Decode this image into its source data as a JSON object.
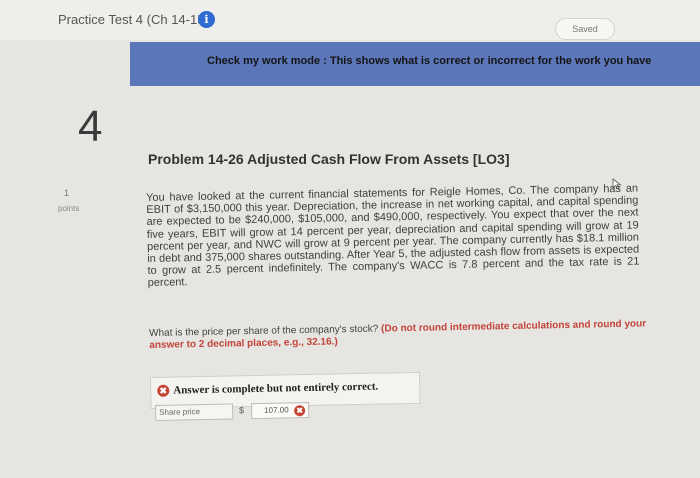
{
  "header": {
    "test_title": "Practice Test 4 (Ch 14-15)",
    "info_glyph": "i",
    "saved_label": "Saved"
  },
  "mode_banner": {
    "text": "Check my work mode : This shows what is correct or incorrect for the work you have"
  },
  "question": {
    "number": "4",
    "points_value": "1",
    "points_label": "points",
    "title": "Problem 14-26 Adjusted Cash Flow From Assets [LO3]",
    "body": "You have looked at the current financial statements for Reigle Homes, Co. The company has an EBIT of $3,150,000 this year. Depreciation, the increase in net working capital, and capital spending are expected to be $240,000, $105,000, and $490,000, respectively. You expect that over the next five years, EBIT will grow at 14 percent per year, depreciation and capital spending will grow at 19 percent per year, and NWC will grow at 9 percent per year. The company currently has $18.1 million in debt and 375,000 shares outstanding. After Year 5, the adjusted cash flow from assets is expected to grow at 2.5 percent indefinitely. The company's WACC is 7.8 percent and the tax rate is 21 percent.",
    "prompt": "What is the price per share of the company's stock?",
    "instruction": "(Do not round intermediate calculations and round your answer to 2 decimal places, e.g., 32.16.)"
  },
  "answer": {
    "status": "Answer is complete but not entirely correct.",
    "status_glyph": "✖",
    "field_label": "Share price",
    "currency": "$",
    "value": "107.00",
    "error_glyph": "✖"
  },
  "colors": {
    "banner": "#5b76b9",
    "info_icon": "#2f6bd1",
    "incorrect": "#c64434",
    "instruction": "#c4433a"
  },
  "icons": [
    "info-icon",
    "cursor-icon",
    "incorrect-x-icon"
  ]
}
